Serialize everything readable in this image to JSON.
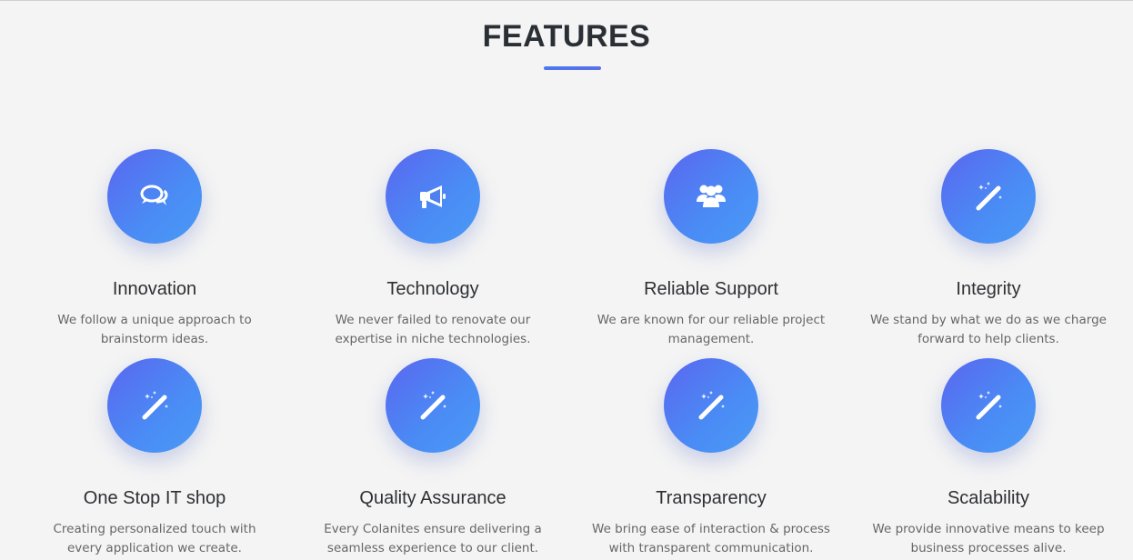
{
  "section": {
    "title": "FEATURES",
    "accent_color": "#4b78ee"
  },
  "features": [
    {
      "icon": "chat-bubbles-icon",
      "title": "Innovation",
      "desc_line1": "We follow a unique approach to",
      "desc_line2": "brainstorm ideas."
    },
    {
      "icon": "megaphone-icon",
      "title": "Technology",
      "desc_line1": "We never failed to renovate our",
      "desc_line2": "expertise in niche technologies."
    },
    {
      "icon": "users-icon",
      "title": "Reliable Support",
      "desc_line1": "We are known for our reliable project",
      "desc_line2": "management."
    },
    {
      "icon": "magic-wand-icon",
      "title": "Integrity",
      "desc_line1": "We stand by what we do as we charge",
      "desc_line2": "forward to help clients."
    },
    {
      "icon": "magic-wand-icon",
      "title": "One Stop IT shop",
      "desc_line1": "Creating personalized touch with",
      "desc_line2": "every application we create."
    },
    {
      "icon": "magic-wand-icon",
      "title": "Quality Assurance",
      "desc_line1": "Every Colanites ensure delivering a",
      "desc_line2": "seamless experience to our client."
    },
    {
      "icon": "magic-wand-icon",
      "title": "Transparency",
      "desc_line1": "We bring ease of interaction & process",
      "desc_line2": "with transparent communication."
    },
    {
      "icon": "magic-wand-icon",
      "title": "Scalability",
      "desc_line1": "We provide innovative means to keep",
      "desc_line2": "business processes alive."
    }
  ]
}
